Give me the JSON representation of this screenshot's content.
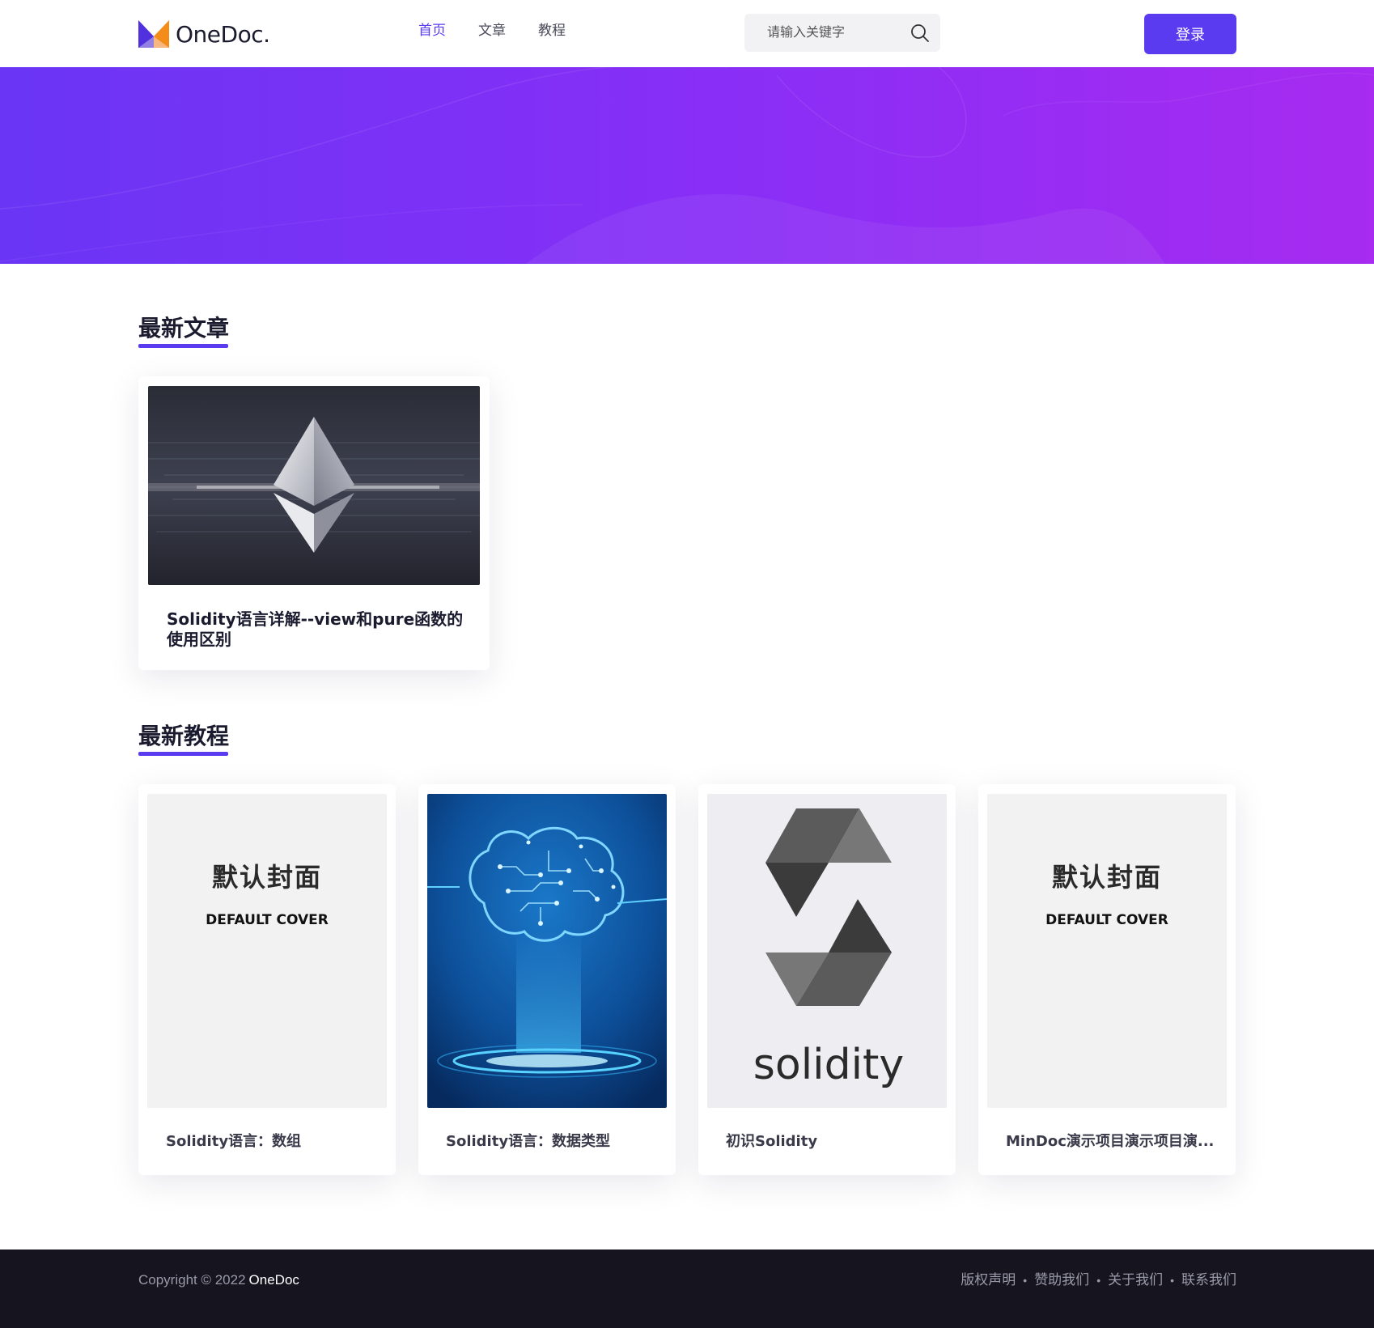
{
  "header": {
    "logo_text": "OneDoc.",
    "nav": [
      {
        "label": "首页",
        "active": true
      },
      {
        "label": "文章",
        "active": false
      },
      {
        "label": "教程",
        "active": false
      }
    ],
    "search_placeholder": "请输入关键字",
    "login_label": "登录"
  },
  "colors": {
    "accent": "#5b3bf0",
    "hero_start": "#6a35f5",
    "hero_end": "#a72bf0",
    "footer_bg": "#15141f"
  },
  "latest_articles": {
    "title": "最新文章",
    "items": [
      {
        "title": "Solidity语言详解--view和pure函数的使用区别",
        "cover": "ethereum-cover"
      }
    ]
  },
  "latest_tutorials": {
    "title": "最新教程",
    "items": [
      {
        "title": "Solidity语言：数组",
        "cover": "default-cover",
        "cover_cn": "默认封面",
        "cover_en": "DEFAULT COVER"
      },
      {
        "title": "Solidity语言：数据类型",
        "cover": "circuit-brain-cover"
      },
      {
        "title": "初识Solidity",
        "cover": "solidity-logo-cover",
        "cover_text": "solidity"
      },
      {
        "title": "MinDoc演示项目演示项目演...",
        "cover": "default-cover",
        "cover_cn": "默认封面",
        "cover_en": "DEFAULT COVER"
      }
    ]
  },
  "footer": {
    "copyright": "Copyright © 2022",
    "brand": "OneDoc",
    "links": [
      "版权声明",
      "赞助我们",
      "关于我们",
      "联系我们"
    ],
    "separator": "•"
  }
}
